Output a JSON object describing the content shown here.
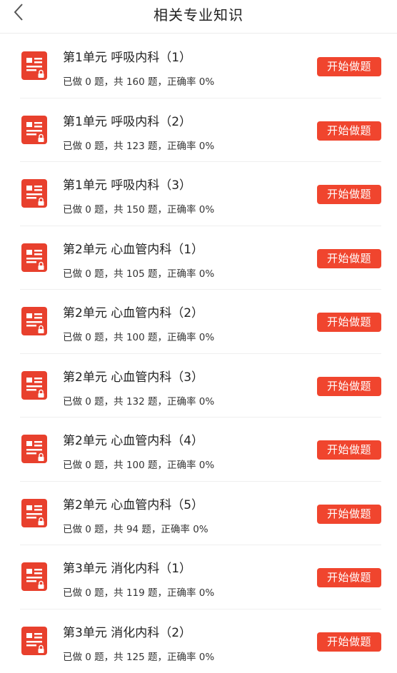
{
  "header": {
    "title": "相关专业知识",
    "back_icon": "chevron-left-icon"
  },
  "colors": {
    "accent": "#f0452e",
    "icon_bg": "#e8402d"
  },
  "units": [
    {
      "title": "第1单元 呼吸内科（1）",
      "stats": "已做 0 题，共 160 题，正确率 0%",
      "button": "开始做题"
    },
    {
      "title": "第1单元 呼吸内科（2）",
      "stats": "已做 0 题，共 123 题，正确率 0%",
      "button": "开始做题"
    },
    {
      "title": "第1单元 呼吸内科（3）",
      "stats": "已做 0 题，共 150 题，正确率 0%",
      "button": "开始做题"
    },
    {
      "title": "第2单元 心血管内科（1）",
      "stats": "已做 0 题，共 105 题，正确率 0%",
      "button": "开始做题"
    },
    {
      "title": "第2单元 心血管内科（2）",
      "stats": "已做 0 题，共 100 题，正确率 0%",
      "button": "开始做题"
    },
    {
      "title": "第2单元 心血管内科（3）",
      "stats": "已做 0 题，共 132 题，正确率 0%",
      "button": "开始做题"
    },
    {
      "title": "第2单元 心血管内科（4）",
      "stats": "已做 0 题，共 100 题，正确率 0%",
      "button": "开始做题"
    },
    {
      "title": "第2单元 心血管内科（5）",
      "stats": "已做 0 题，共 94 题，正确率 0%",
      "button": "开始做题"
    },
    {
      "title": "第3单元 消化内科（1）",
      "stats": "已做 0 题，共 119 题，正确率 0%",
      "button": "开始做题"
    },
    {
      "title": "第3单元 消化内科（2）",
      "stats": "已做 0 题，共 125 题，正确率 0%",
      "button": "开始做题"
    }
  ]
}
